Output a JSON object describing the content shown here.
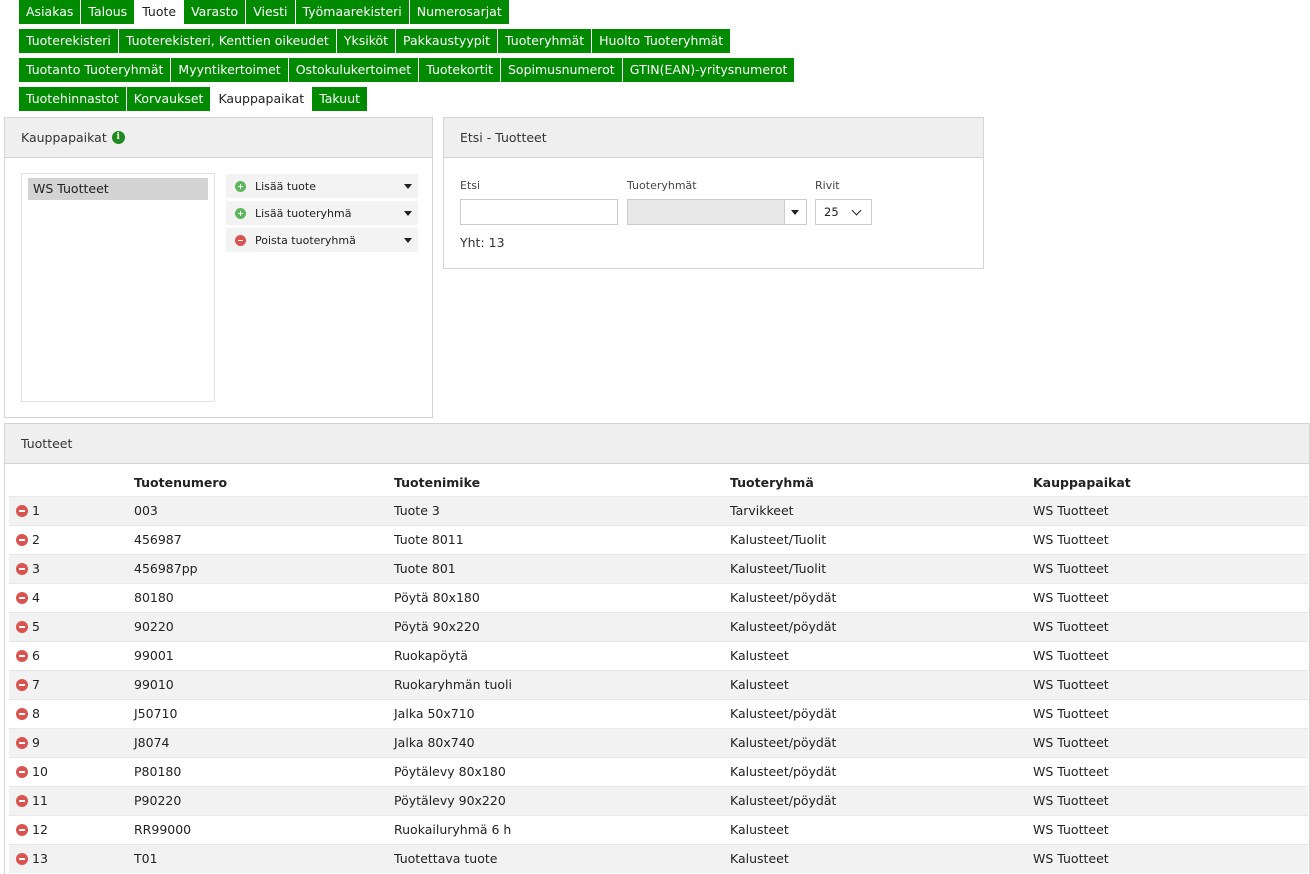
{
  "nav": {
    "row1": [
      "Asiakas",
      "Talous",
      "Tuote",
      "Varasto",
      "Viesti",
      "Työmaarekisteri",
      "Numerosarjat"
    ],
    "row2": [
      "Tuoterekisteri",
      "Tuoterekisteri, Kenttien oikeudet",
      "Yksiköt",
      "Pakkaustyypit",
      "Tuoteryhmät",
      "Huolto Tuoteryhmät"
    ],
    "row3": [
      "Tuotanto Tuoteryhmät",
      "Myyntikertoimet",
      "Ostokulukertoimet",
      "Tuotekortit",
      "Sopimusnumerot",
      "GTIN(EAN)-yritysnumerot"
    ],
    "row4": [
      "Tuotehinnastot",
      "Korvaukset",
      "Kauppapaikat",
      "Takuut"
    ],
    "active": "Tuote / Kauppapaikat"
  },
  "marketplaces": {
    "title": "Kauppapaikat",
    "info_icon": "i",
    "items": [
      "WS Tuotteet"
    ],
    "actions": {
      "add_product": "Lisää tuote",
      "add_group": "Lisää tuoteryhmä",
      "remove_group": "Poista tuoteryhmä"
    }
  },
  "search": {
    "title": "Etsi - Tuotteet",
    "search_label": "Etsi",
    "search_value": "",
    "group_label": "Tuoteryhmät",
    "group_value": "",
    "rows_label": "Rivit",
    "rows_value": "25",
    "total": "Yht: 13"
  },
  "products": {
    "title": "Tuotteet",
    "columns": [
      "",
      "Tuotenumero",
      "Tuotenimike",
      "Tuoteryhmä",
      "Kauppapaikat"
    ],
    "rows": [
      [
        "1",
        "003",
        "Tuote 3",
        "Tarvikkeet",
        "WS Tuotteet"
      ],
      [
        "2",
        "456987",
        "Tuote 8011",
        "Kalusteet/Tuolit",
        "WS Tuotteet"
      ],
      [
        "3",
        "456987pp",
        "Tuote 801",
        "Kalusteet/Tuolit",
        "WS Tuotteet"
      ],
      [
        "4",
        "80180",
        "Pöytä 80x180",
        "Kalusteet/pöydät",
        "WS Tuotteet"
      ],
      [
        "5",
        "90220",
        "Pöytä 90x220",
        "Kalusteet/pöydät",
        "WS Tuotteet"
      ],
      [
        "6",
        "99001",
        "Ruokapöytä",
        "Kalusteet",
        "WS Tuotteet"
      ],
      [
        "7",
        "99010",
        "Ruokaryhmän tuoli",
        "Kalusteet",
        "WS Tuotteet"
      ],
      [
        "8",
        "J50710",
        "Jalka 50x710",
        "Kalusteet/pöydät",
        "WS Tuotteet"
      ],
      [
        "9",
        "J8074",
        "Jalka 80x740",
        "Kalusteet/pöydät",
        "WS Tuotteet"
      ],
      [
        "10",
        "P80180",
        "Pöytälevy 80x180",
        "Kalusteet/pöydät",
        "WS Tuotteet"
      ],
      [
        "11",
        "P90220",
        "Pöytälevy 90x220",
        "Kalusteet/pöydät",
        "WS Tuotteet"
      ],
      [
        "12",
        "RR99000",
        "Ruokailuryhmä 6 h",
        "Kalusteet",
        "WS Tuotteet"
      ],
      [
        "13",
        "T01",
        "Tuotettava tuote",
        "Kalusteet",
        "WS Tuotteet"
      ]
    ]
  },
  "colors": {
    "nav_green": "#008a00",
    "remove_red": "#d9534f",
    "add_green": "#5cb85c"
  }
}
